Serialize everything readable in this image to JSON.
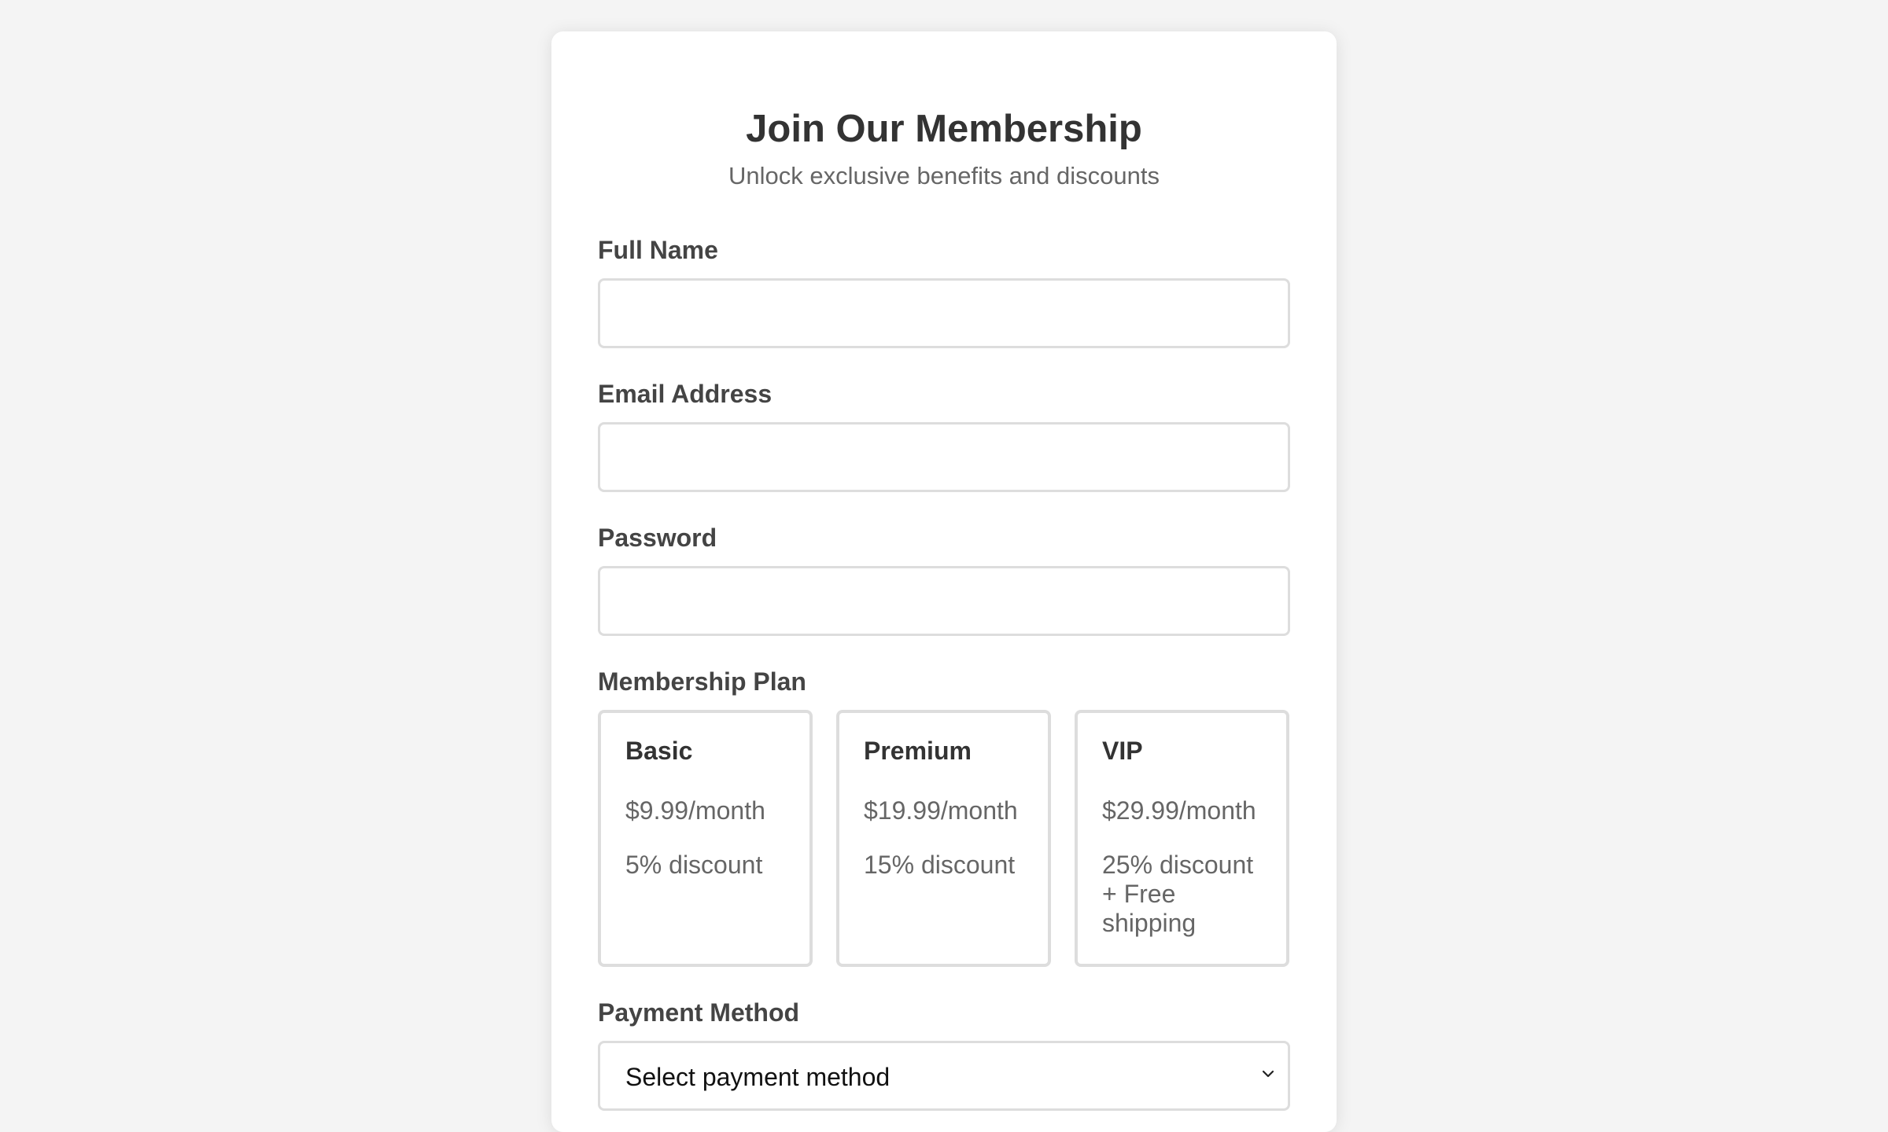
{
  "form": {
    "title": "Join Our Membership",
    "subtitle": "Unlock exclusive benefits and discounts",
    "full_name": {
      "label": "Full Name",
      "value": "",
      "placeholder": ""
    },
    "email": {
      "label": "Email Address",
      "value": "",
      "placeholder": ""
    },
    "password": {
      "label": "Password",
      "value": "",
      "placeholder": ""
    },
    "plan_label": "Membership Plan",
    "plans": [
      {
        "name": "Basic",
        "price": "$9.99/month",
        "discount": "5% discount"
      },
      {
        "name": "Premium",
        "price": "$19.99/month",
        "discount": "15% discount"
      },
      {
        "name": "VIP",
        "price": "$29.99/month",
        "discount": "25% discount + Free shipping"
      }
    ],
    "payment": {
      "label": "Payment Method",
      "selected": "Select payment method",
      "icon": "chevron-down-icon"
    }
  },
  "colors": {
    "background": "#f4f4f4",
    "card": "#ffffff",
    "border": "#dddddd",
    "heading": "#333333",
    "label": "#444444",
    "muted": "#666666"
  }
}
